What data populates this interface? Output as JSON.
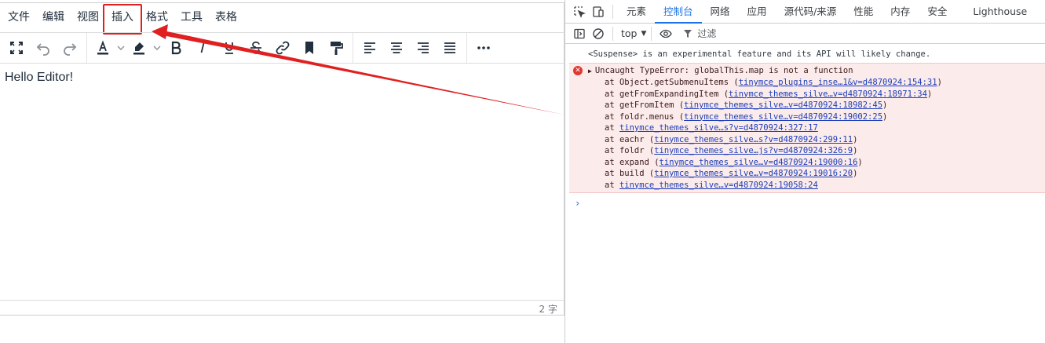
{
  "editor": {
    "menubar": [
      "文件",
      "编辑",
      "视图",
      "插入",
      "格式",
      "工具",
      "表格"
    ],
    "highlighted_menu_index": 3,
    "content_text": "Hello Editor!",
    "wordcount": "2 字",
    "toolbar_icons": [
      [
        "fullscreen-icon",
        "undo-icon",
        "redo-icon"
      ],
      [
        "text-color-icon",
        "highlight-color-icon",
        "bold-icon",
        "italic-icon",
        "underline-icon",
        "strikethrough-icon",
        "link-icon",
        "bookmark-icon",
        "format-painter-icon"
      ],
      [
        "align-left-icon",
        "align-center-icon",
        "align-right-icon",
        "align-justify-icon"
      ],
      [
        "more-icon"
      ]
    ],
    "colors": {
      "annotation_red": "#e02020",
      "text_color_bar": "#222f3e"
    }
  },
  "devtools": {
    "tabs": [
      "元素",
      "控制台",
      "网络",
      "应用",
      "源代码/来源",
      "性能",
      "内存",
      "安全",
      "Lighthouse"
    ],
    "active_tab_index": 1,
    "context": "top",
    "filter_placeholder": "过滤",
    "console": {
      "warning": "<Suspense> is an experimental feature and its API will likely change.",
      "error_message": "Uncaught TypeError: globalThis.map is not a function",
      "frames": [
        {
          "prefix": "at Object.getSubmenuItems (",
          "link": "tinymce_plugins_inse…1&v=d4870924:154:31",
          "suffix": ")"
        },
        {
          "prefix": "at getFromExpandingItem (",
          "link": "tinymce_themes_silve…v=d4870924:18971:34",
          "suffix": ")"
        },
        {
          "prefix": "at getFromItem (",
          "link": "tinymce_themes_silve…v=d4870924:18982:45",
          "suffix": ")"
        },
        {
          "prefix": "at foldr.menus (",
          "link": "tinymce_themes_silve…v=d4870924:19002:25",
          "suffix": ")"
        },
        {
          "prefix": "at ",
          "link": "tinymce_themes_silve…s?v=d4870924:327:17",
          "suffix": ""
        },
        {
          "prefix": "at eachr (",
          "link": "tinymce_themes_silve…s?v=d4870924:299:11",
          "suffix": ")"
        },
        {
          "prefix": "at foldr (",
          "link": "tinymce_themes_silve…js?v=d4870924:326:9",
          "suffix": ")"
        },
        {
          "prefix": "at expand (",
          "link": "tinymce_themes_silve…v=d4870924:19000:16",
          "suffix": ")"
        },
        {
          "prefix": "at build (",
          "link": "tinymce_themes_silve…v=d4870924:19016:20",
          "suffix": ")"
        },
        {
          "prefix": "at ",
          "link": "tinymce_themes_silve…v=d4870924:19058:24",
          "suffix": ""
        }
      ],
      "prompt": "›"
    },
    "colors": {
      "active_tab": "#1a73e8",
      "error_bg": "#fcebeb",
      "error_icon": "#e0382f",
      "link": "#1a3eb8"
    }
  }
}
